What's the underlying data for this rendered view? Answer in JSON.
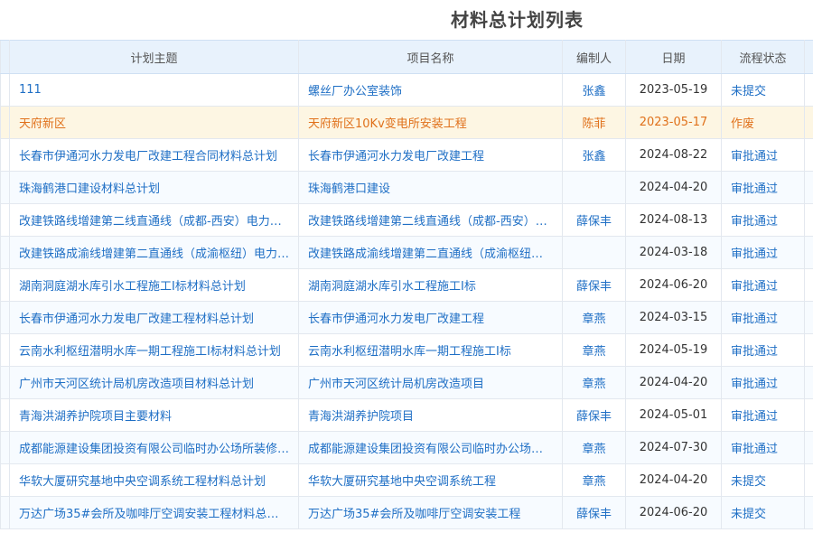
{
  "page": {
    "title": "材料总计划列表"
  },
  "table": {
    "columns": [
      "计划主题",
      "项目名称",
      "编制人",
      "日期",
      "流程状态"
    ],
    "rows": [
      {
        "topic": "111",
        "project": "螺丝厂办公室装饰",
        "author": "张鑫",
        "date": "2023-05-19",
        "status": "未提交",
        "status_type": "pending",
        "highlight": false
      },
      {
        "topic": "天府新区",
        "project": "天府新区10Kv变电所安装工程",
        "author": "陈菲",
        "date": "2023-05-17",
        "status": "作废",
        "status_type": "void",
        "highlight": true
      },
      {
        "topic": "长春市伊通河水力发电厂改建工程合同材料总计划",
        "project": "长春市伊通河水力发电厂改建工程",
        "author": "张鑫",
        "date": "2024-08-22",
        "status": "审批通过",
        "status_type": "approved",
        "highlight": false
      },
      {
        "topic": "珠海鹤港口建设材料总计划",
        "project": "珠海鹤港口建设",
        "author": "",
        "date": "2024-04-20",
        "status": "审批通过",
        "status_type": "approved",
        "highlight": false
      },
      {
        "topic": "改建铁路线增建第二线直通线（成都-西安）电力…",
        "project": "改建铁路线增建第二线直通线（成都-西安）…",
        "author": "薛保丰",
        "date": "2024-08-13",
        "status": "审批通过",
        "status_type": "approved",
        "highlight": false
      },
      {
        "topic": "改建铁路成渝线增建第二直通线（成渝枢纽）电力…",
        "project": "改建铁路成渝线增建第二直通线（成渝枢纽…",
        "author": "",
        "date": "2024-03-18",
        "status": "审批通过",
        "status_type": "approved",
        "highlight": false
      },
      {
        "topic": "湖南洞庭湖水库引水工程施工I标材料总计划",
        "project": "湖南洞庭湖水库引水工程施工I标",
        "author": "薛保丰",
        "date": "2024-06-20",
        "status": "审批通过",
        "status_type": "approved",
        "highlight": false
      },
      {
        "topic": "长春市伊通河水力发电厂改建工程材料总计划",
        "project": "长春市伊通河水力发电厂改建工程",
        "author": "章燕",
        "date": "2024-03-15",
        "status": "审批通过",
        "status_type": "approved",
        "highlight": false
      },
      {
        "topic": "云南水利枢纽潜明水库一期工程施工I标材料总计划",
        "project": "云南水利枢纽潜明水库一期工程施工I标",
        "author": "章燕",
        "date": "2024-05-19",
        "status": "审批通过",
        "status_type": "approved",
        "highlight": false
      },
      {
        "topic": "广州市天河区统计局机房改造项目材料总计划",
        "project": "广州市天河区统计局机房改造项目",
        "author": "章燕",
        "date": "2024-04-20",
        "status": "审批通过",
        "status_type": "approved",
        "highlight": false
      },
      {
        "topic": "青海洪湖养护院项目主要材料",
        "project": "青海洪湖养护院项目",
        "author": "薛保丰",
        "date": "2024-05-01",
        "status": "审批通过",
        "status_type": "approved",
        "highlight": false
      },
      {
        "topic": "成都能源建设集团投资有限公司临时办公场所装修…",
        "project": "成都能源建设集团投资有限公司临时办公场…",
        "author": "章燕",
        "date": "2024-07-30",
        "status": "审批通过",
        "status_type": "approved",
        "highlight": false
      },
      {
        "topic": "华软大厦研究基地中央空调系统工程材料总计划",
        "project": "华软大厦研究基地中央空调系统工程",
        "author": "章燕",
        "date": "2024-04-20",
        "status": "未提交",
        "status_type": "pending",
        "highlight": false
      },
      {
        "topic": "万达广场35#会所及咖啡厅空调安装工程材料总计划",
        "project": "万达广场35#会所及咖啡厅空调安装工程",
        "author": "薛保丰",
        "date": "2024-06-20",
        "status": "未提交",
        "status_type": "pending",
        "highlight": false
      }
    ]
  }
}
